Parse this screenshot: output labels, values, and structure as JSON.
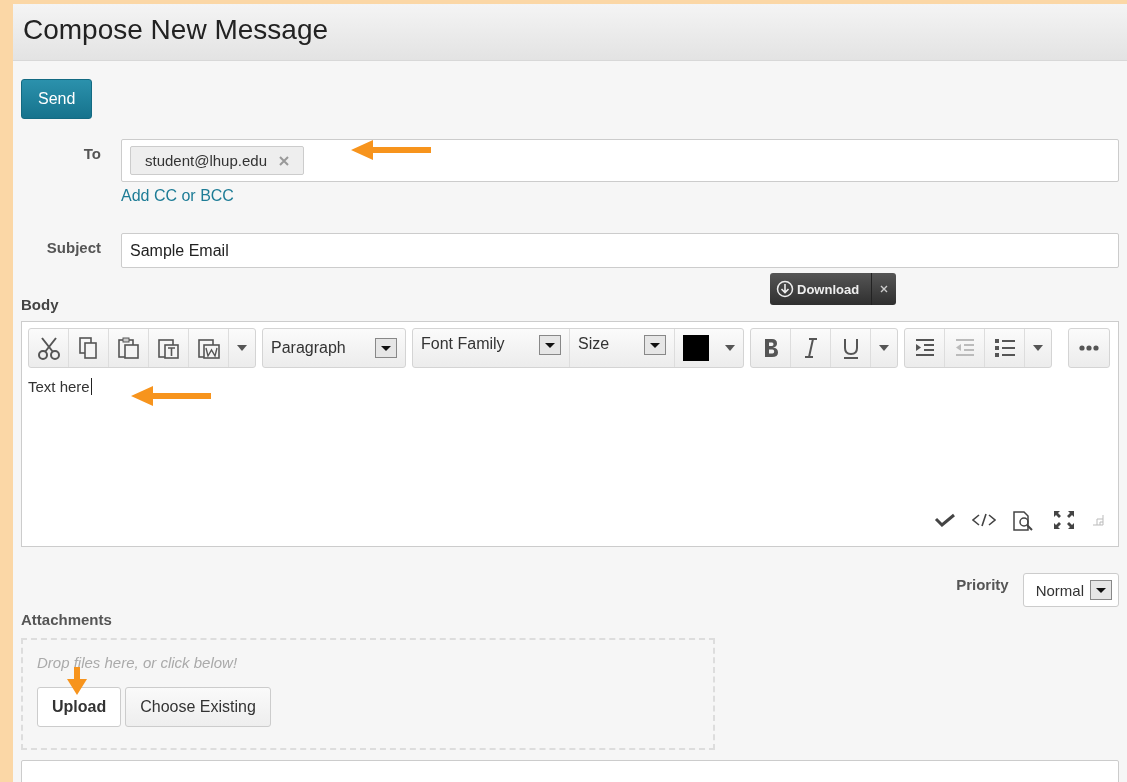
{
  "window": {
    "title": "Compose New Message"
  },
  "send_button": "Send",
  "to": {
    "label": "To",
    "recipients": [
      {
        "address": "student@lhup.edu"
      }
    ],
    "add_cc_link": "Add CC or BCC"
  },
  "subject": {
    "label": "Subject",
    "value": "Sample Email"
  },
  "download_popup": {
    "label": "Download"
  },
  "body": {
    "label": "Body",
    "text": "Text here",
    "toolbar": [
      {
        "items": [
          {
            "kind": "cut",
            "disabled": false
          },
          {
            "kind": "copy",
            "disabled": false
          },
          {
            "kind": "paste",
            "disabled": false
          },
          {
            "kind": "pastetext",
            "disabled": false
          },
          {
            "kind": "pasteword",
            "disabled": false
          },
          {
            "kind": "caret",
            "disabled": false
          }
        ]
      },
      {
        "items": [
          {
            "kind": "select",
            "label": "Paragraph",
            "disabled": false
          }
        ]
      },
      {
        "items": [
          {
            "kind": "select",
            "label": "Font Family",
            "disabled": false
          },
          {
            "kind": "select",
            "label": "Size",
            "disabled": false
          },
          {
            "kind": "color",
            "color": "#000000",
            "disabled": false
          },
          {
            "kind": "caret",
            "disabled": false
          }
        ]
      },
      {
        "items": [
          {
            "kind": "bold",
            "disabled": false
          },
          {
            "kind": "italic",
            "disabled": false
          },
          {
            "kind": "underline",
            "disabled": false
          },
          {
            "kind": "caret",
            "disabled": false
          }
        ]
      },
      {
        "items": [
          {
            "kind": "indent",
            "disabled": false
          },
          {
            "kind": "outdent",
            "disabled": true
          },
          {
            "kind": "list",
            "disabled": false
          },
          {
            "kind": "caret",
            "disabled": false
          }
        ]
      },
      {
        "items": [
          {
            "kind": "more",
            "disabled": false
          }
        ]
      }
    ]
  },
  "priority": {
    "label": "Priority",
    "value": "Normal"
  },
  "attachments": {
    "label": "Attachments",
    "drop_hint": "Drop files here, or click below!",
    "buttons": [
      "Upload",
      "Choose Existing"
    ]
  }
}
